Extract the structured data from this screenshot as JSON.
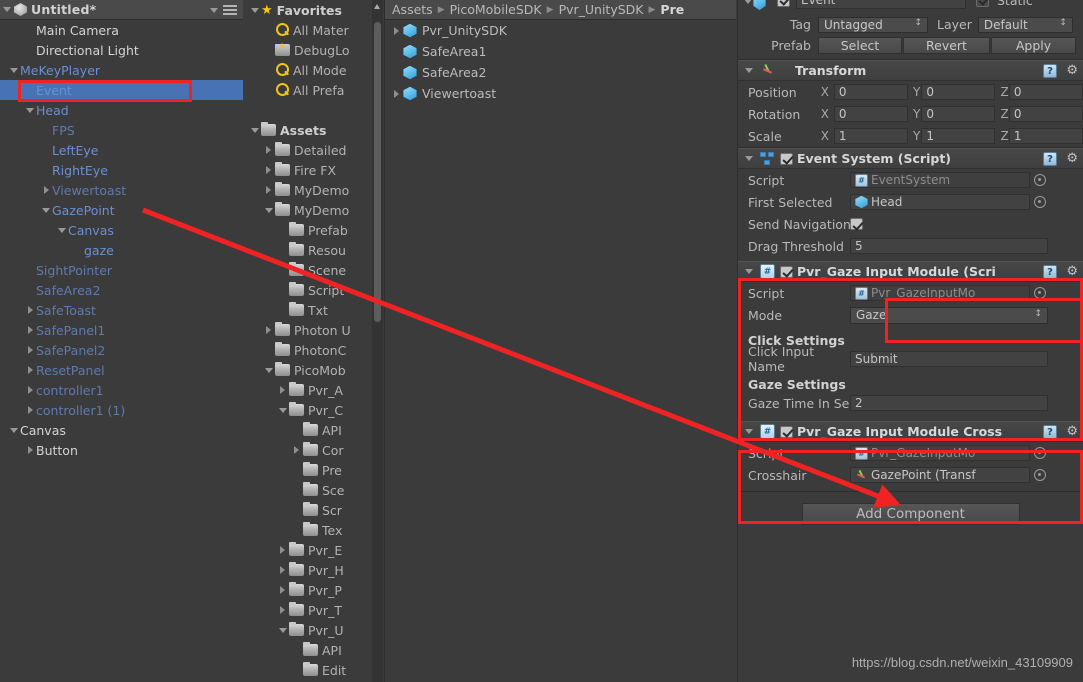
{
  "hierarchy": {
    "scene_title": "Untitled*",
    "menu_icon": "hamburger-menu-icon",
    "items": [
      {
        "label": "Main Camera",
        "indent": 1,
        "arrow": "none",
        "color": "white",
        "selected": false
      },
      {
        "label": "Directional Light",
        "indent": 1,
        "arrow": "none",
        "color": "white",
        "selected": false
      },
      {
        "label": "MeKeyPlayer",
        "indent": 0,
        "arrow": "down",
        "color": "blue",
        "selected": false
      },
      {
        "label": "Event",
        "indent": 1,
        "arrow": "none",
        "color": "blue",
        "selected": true
      },
      {
        "label": "Head",
        "indent": 1,
        "arrow": "down",
        "color": "blue",
        "selected": false
      },
      {
        "label": "FPS",
        "indent": 2,
        "arrow": "none",
        "color": "bluedim",
        "selected": false
      },
      {
        "label": "LeftEye",
        "indent": 2,
        "arrow": "none",
        "color": "blue",
        "selected": false
      },
      {
        "label": "RightEye",
        "indent": 2,
        "arrow": "none",
        "color": "blue",
        "selected": false
      },
      {
        "label": "Viewertoast",
        "indent": 2,
        "arrow": "right",
        "color": "bluedim",
        "selected": false
      },
      {
        "label": "GazePoint",
        "indent": 2,
        "arrow": "down",
        "color": "blue",
        "selected": false
      },
      {
        "label": "Canvas",
        "indent": 3,
        "arrow": "down",
        "color": "blue",
        "selected": false
      },
      {
        "label": "gaze",
        "indent": 4,
        "arrow": "none",
        "color": "blue",
        "selected": false
      },
      {
        "label": "SightPointer",
        "indent": 1,
        "arrow": "none",
        "color": "bluedim",
        "selected": false
      },
      {
        "label": "SafeArea2",
        "indent": 1,
        "arrow": "none",
        "color": "bluedim",
        "selected": false
      },
      {
        "label": "SafeToast",
        "indent": 1,
        "arrow": "right",
        "color": "bluedim",
        "selected": false
      },
      {
        "label": "SafePanel1",
        "indent": 1,
        "arrow": "right",
        "color": "bluedim",
        "selected": false
      },
      {
        "label": "SafePanel2",
        "indent": 1,
        "arrow": "right",
        "color": "bluedim",
        "selected": false
      },
      {
        "label": "ResetPanel",
        "indent": 1,
        "arrow": "right",
        "color": "bluedim",
        "selected": false
      },
      {
        "label": "controller1",
        "indent": 1,
        "arrow": "right",
        "color": "bluedim",
        "selected": false
      },
      {
        "label": "controller1 (1)",
        "indent": 1,
        "arrow": "right",
        "color": "bluedim",
        "selected": false
      },
      {
        "label": "Canvas",
        "indent": 0,
        "arrow": "down",
        "color": "white",
        "selected": false
      },
      {
        "label": "Button",
        "indent": 1,
        "arrow": "right",
        "color": "white",
        "selected": false
      }
    ]
  },
  "project_tree": {
    "favorites_label": "Favorites",
    "assets_label": "Assets",
    "items": [
      {
        "label": "Favorites",
        "indent": 0,
        "arrow": "down",
        "icon": "star-icon",
        "bold": true
      },
      {
        "label": "All Mater",
        "indent": 1,
        "arrow": "none",
        "icon": "search-icon",
        "bold": false
      },
      {
        "label": "DebugLo",
        "indent": 1,
        "arrow": "none",
        "icon": "fav-folder-icon",
        "bold": false
      },
      {
        "label": "All Mode",
        "indent": 1,
        "arrow": "none",
        "icon": "search-icon",
        "bold": false
      },
      {
        "label": "All Prefa",
        "indent": 1,
        "arrow": "none",
        "icon": "search-icon",
        "bold": false
      },
      {
        "label": "",
        "indent": 0,
        "arrow": "none",
        "icon": "none",
        "bold": false
      },
      {
        "label": "Assets",
        "indent": 0,
        "arrow": "down",
        "icon": "folder-icon",
        "bold": true
      },
      {
        "label": "Detailed",
        "indent": 1,
        "arrow": "right",
        "icon": "folder-icon",
        "bold": false
      },
      {
        "label": "Fire FX",
        "indent": 1,
        "arrow": "right",
        "icon": "folder-icon",
        "bold": false
      },
      {
        "label": "MyDemo",
        "indent": 1,
        "arrow": "right",
        "icon": "folder-icon",
        "bold": false
      },
      {
        "label": "MyDemo",
        "indent": 1,
        "arrow": "down",
        "icon": "folder-icon",
        "bold": false
      },
      {
        "label": "Prefab",
        "indent": 2,
        "arrow": "none",
        "icon": "folder-icon",
        "bold": false
      },
      {
        "label": "Resou",
        "indent": 2,
        "arrow": "none",
        "icon": "folder-icon",
        "bold": false
      },
      {
        "label": "Scene",
        "indent": 2,
        "arrow": "none",
        "icon": "folder-icon",
        "bold": false
      },
      {
        "label": "Script",
        "indent": 2,
        "arrow": "none",
        "icon": "folder-icon",
        "bold": false
      },
      {
        "label": "Txt",
        "indent": 2,
        "arrow": "none",
        "icon": "folder-icon",
        "bold": false
      },
      {
        "label": "Photon U",
        "indent": 1,
        "arrow": "right",
        "icon": "folder-icon",
        "bold": false
      },
      {
        "label": "PhotonC",
        "indent": 1,
        "arrow": "none",
        "icon": "folder-icon",
        "bold": false
      },
      {
        "label": "PicoMob",
        "indent": 1,
        "arrow": "down",
        "icon": "folder-icon",
        "bold": false
      },
      {
        "label": "Pvr_A",
        "indent": 2,
        "arrow": "right",
        "icon": "folder-icon",
        "bold": false
      },
      {
        "label": "Pvr_C",
        "indent": 2,
        "arrow": "down",
        "icon": "folder-icon",
        "bold": false
      },
      {
        "label": "API",
        "indent": 3,
        "arrow": "none",
        "icon": "folder-icon",
        "bold": false
      },
      {
        "label": "Cor",
        "indent": 3,
        "arrow": "right",
        "icon": "folder-icon",
        "bold": false
      },
      {
        "label": "Pre",
        "indent": 3,
        "arrow": "none",
        "icon": "folder-icon",
        "bold": false
      },
      {
        "label": "Sce",
        "indent": 3,
        "arrow": "none",
        "icon": "folder-icon",
        "bold": false
      },
      {
        "label": "Scr",
        "indent": 3,
        "arrow": "none",
        "icon": "folder-icon",
        "bold": false
      },
      {
        "label": "Tex",
        "indent": 3,
        "arrow": "none",
        "icon": "folder-icon",
        "bold": false
      },
      {
        "label": "Pvr_E",
        "indent": 2,
        "arrow": "right",
        "icon": "folder-icon",
        "bold": false
      },
      {
        "label": "Pvr_H",
        "indent": 2,
        "arrow": "right",
        "icon": "folder-icon",
        "bold": false
      },
      {
        "label": "Pvr_P",
        "indent": 2,
        "arrow": "right",
        "icon": "folder-icon",
        "bold": false
      },
      {
        "label": "Pvr_T",
        "indent": 2,
        "arrow": "right",
        "icon": "folder-icon",
        "bold": false
      },
      {
        "label": "Pvr_U",
        "indent": 2,
        "arrow": "down",
        "icon": "folder-icon",
        "bold": false
      },
      {
        "label": "API",
        "indent": 3,
        "arrow": "none",
        "icon": "folder-icon",
        "bold": false
      },
      {
        "label": "Edit",
        "indent": 3,
        "arrow": "none",
        "icon": "folder-icon",
        "bold": false
      }
    ]
  },
  "project_content": {
    "breadcrumb": [
      "Assets",
      "PicoMobileSDK",
      "Pvr_UnitySDK",
      "Pre"
    ],
    "items": [
      {
        "label": "Pvr_UnitySDK",
        "arrow": "right",
        "icon": "prefab-cube-icon"
      },
      {
        "label": "SafeArea1",
        "arrow": "none",
        "icon": "prefab-cube-icon"
      },
      {
        "label": "SafeArea2",
        "arrow": "none",
        "icon": "prefab-cube-icon"
      },
      {
        "label": "Viewertoast",
        "arrow": "right",
        "icon": "prefab-cube-icon"
      }
    ]
  },
  "inspector": {
    "object_name": "Event",
    "static_label": "Static",
    "tag_label": "Tag",
    "tag_value": "Untagged",
    "layer_label": "Layer",
    "layer_value": "Default",
    "prefab_label": "Prefab",
    "prefab_buttons": [
      "Select",
      "Revert",
      "Apply"
    ],
    "transform": {
      "title": "Transform",
      "rows": [
        {
          "label": "Position",
          "x": "0",
          "y": "0",
          "z": "0"
        },
        {
          "label": "Rotation",
          "x": "0",
          "y": "0",
          "z": "0"
        },
        {
          "label": "Scale",
          "x": "1",
          "y": "1",
          "z": "1"
        }
      ]
    },
    "event_system": {
      "title": "Event System (Script)",
      "enabled": true,
      "rows": [
        {
          "label": "Script",
          "value": "EventSystem",
          "type": "objref-dim",
          "icon": "cs-script-icon"
        },
        {
          "label": "First Selected",
          "value": "Head",
          "type": "objref",
          "icon": "cube-icon"
        },
        {
          "label": "Send Navigation Eve",
          "value": "",
          "type": "checkbox",
          "icon": "none"
        },
        {
          "label": "Drag Threshold",
          "value": "5",
          "type": "text",
          "icon": "none"
        }
      ]
    },
    "gaze_module": {
      "title": "Pvr_Gaze Input Module (Scri",
      "enabled": true,
      "script_label": "Script",
      "script_value": "Pvr_GazeInputMo",
      "mode_label": "Mode",
      "mode_value": "Gaze",
      "click_settings_label": "Click Settings",
      "click_input_name_label": "Click Input Name",
      "click_input_name_value": "Submit",
      "gaze_settings_label": "Gaze Settings",
      "gaze_time_label": "Gaze Time In Secon",
      "gaze_time_value": "2"
    },
    "crosshair_module": {
      "title": "Pvr_Gaze Input Module Cross",
      "enabled": true,
      "script_label": "Script",
      "script_value": "Pvr_GazeInputMo",
      "crosshair_label": "Crosshair",
      "crosshair_value": "GazePoint (Transf"
    },
    "add_component_label": "Add Component"
  },
  "annotations": {
    "watermark": "https://blog.csdn.net/weixin_43109909",
    "highlight_color": "#ef2323"
  }
}
